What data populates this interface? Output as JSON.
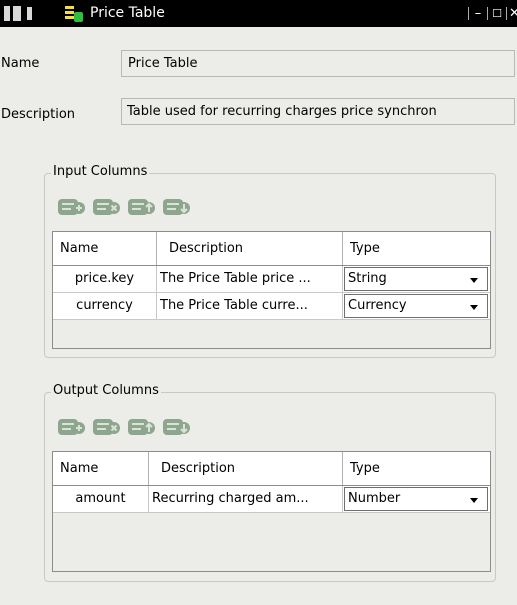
{
  "window": {
    "title": "Price Table",
    "controls": {
      "minimize": "–",
      "maximize": "☐",
      "close": "✕"
    }
  },
  "form": {
    "name_label": "Name",
    "name_value": "Price Table",
    "description_label": "Description",
    "description_value": "Table used for recurring charges price synchron"
  },
  "input_columns": {
    "legend": "Input Columns",
    "headers": {
      "name": "Name",
      "description": "Description",
      "type": "Type"
    },
    "rows": [
      {
        "name": "price.key",
        "description": "The Price Table price ...",
        "type": "String"
      },
      {
        "name": "currency",
        "description": "The Price Table curre...",
        "type": "Currency"
      }
    ]
  },
  "output_columns": {
    "legend": "Output Columns",
    "headers": {
      "name": "Name",
      "description": "Description",
      "type": "Type"
    },
    "rows": [
      {
        "name": "amount",
        "description": "Recurring charged am...",
        "type": "Number"
      }
    ]
  },
  "toolbar_icons": [
    "add-row-icon",
    "delete-row-icon",
    "move-up-icon",
    "move-down-icon"
  ],
  "colors": {
    "titlebar": "#000000",
    "window_bg": "#ecece9",
    "table_bg": "#ffffff",
    "icon_green": "#8ea58e"
  }
}
